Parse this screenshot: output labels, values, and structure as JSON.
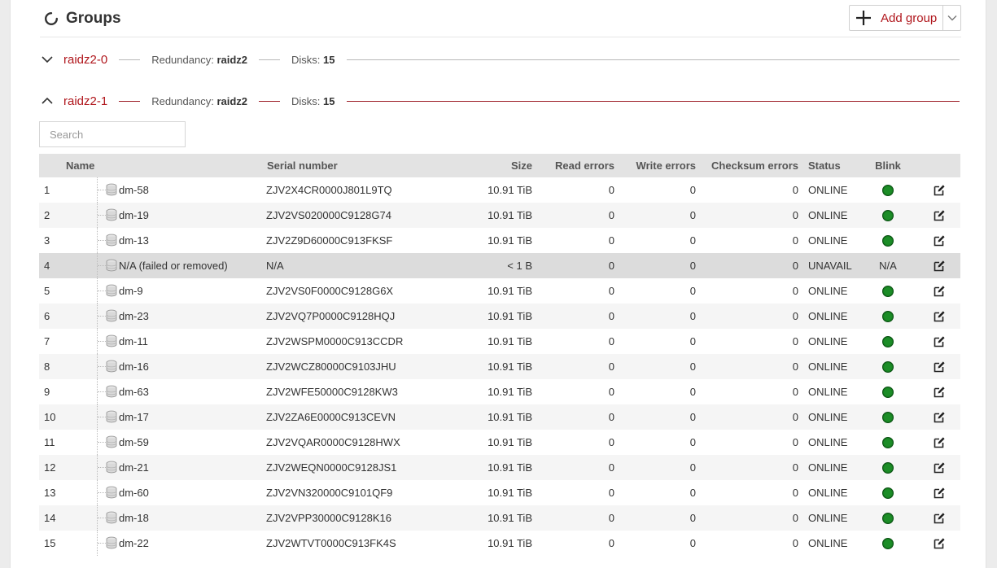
{
  "header": {
    "title": "Groups",
    "add_group_label": "Add group"
  },
  "groups": [
    {
      "name": "raidz2-0",
      "expanded": false,
      "redundancy_label": "Redundancy:",
      "redundancy": "raidz2",
      "disks_label": "Disks:",
      "disks": "15"
    },
    {
      "name": "raidz2-1",
      "expanded": true,
      "redundancy_label": "Redundancy:",
      "redundancy": "raidz2",
      "disks_label": "Disks:",
      "disks": "15"
    }
  ],
  "search": {
    "placeholder": "Search",
    "value": ""
  },
  "table": {
    "columns": [
      "Name",
      "Serial number",
      "Size",
      "Read errors",
      "Write errors",
      "Checksum errors",
      "Status",
      "Blink"
    ],
    "rows": [
      {
        "index": "1",
        "name": "dm-58",
        "serial": "ZJV2X4CR0000J801L9TQ",
        "size": "10.91 TiB",
        "read": "0",
        "write": "0",
        "checksum": "0",
        "status": "ONLINE",
        "blink": "dot"
      },
      {
        "index": "2",
        "name": "dm-19",
        "serial": "ZJV2VS020000C9128G74",
        "size": "10.91 TiB",
        "read": "0",
        "write": "0",
        "checksum": "0",
        "status": "ONLINE",
        "blink": "dot"
      },
      {
        "index": "3",
        "name": "dm-13",
        "serial": "ZJV2Z9D60000C913FKSF",
        "size": "10.91 TiB",
        "read": "0",
        "write": "0",
        "checksum": "0",
        "status": "ONLINE",
        "blink": "dot"
      },
      {
        "index": "4",
        "name": "N/A (failed or removed)",
        "serial": "N/A",
        "size": "< 1 B",
        "read": "0",
        "write": "0",
        "checksum": "0",
        "status": "UNAVAIL",
        "blink": "N/A"
      },
      {
        "index": "5",
        "name": "dm-9",
        "serial": "ZJV2VS0F0000C9128G6X",
        "size": "10.91 TiB",
        "read": "0",
        "write": "0",
        "checksum": "0",
        "status": "ONLINE",
        "blink": "dot"
      },
      {
        "index": "6",
        "name": "dm-23",
        "serial": "ZJV2VQ7P0000C9128HQJ",
        "size": "10.91 TiB",
        "read": "0",
        "write": "0",
        "checksum": "0",
        "status": "ONLINE",
        "blink": "dot"
      },
      {
        "index": "7",
        "name": "dm-11",
        "serial": "ZJV2WSPM0000C913CCDR",
        "size": "10.91 TiB",
        "read": "0",
        "write": "0",
        "checksum": "0",
        "status": "ONLINE",
        "blink": "dot"
      },
      {
        "index": "8",
        "name": "dm-16",
        "serial": "ZJV2WCZ80000C9103JHU",
        "size": "10.91 TiB",
        "read": "0",
        "write": "0",
        "checksum": "0",
        "status": "ONLINE",
        "blink": "dot"
      },
      {
        "index": "9",
        "name": "dm-63",
        "serial": "ZJV2WFE50000C9128KW3",
        "size": "10.91 TiB",
        "read": "0",
        "write": "0",
        "checksum": "0",
        "status": "ONLINE",
        "blink": "dot"
      },
      {
        "index": "10",
        "name": "dm-17",
        "serial": "ZJV2ZA6E0000C913CEVN",
        "size": "10.91 TiB",
        "read": "0",
        "write": "0",
        "checksum": "0",
        "status": "ONLINE",
        "blink": "dot"
      },
      {
        "index": "11",
        "name": "dm-59",
        "serial": "ZJV2VQAR0000C9128HWX",
        "size": "10.91 TiB",
        "read": "0",
        "write": "0",
        "checksum": "0",
        "status": "ONLINE",
        "blink": "dot"
      },
      {
        "index": "12",
        "name": "dm-21",
        "serial": "ZJV2WEQN0000C9128JS1",
        "size": "10.91 TiB",
        "read": "0",
        "write": "0",
        "checksum": "0",
        "status": "ONLINE",
        "blink": "dot"
      },
      {
        "index": "13",
        "name": "dm-60",
        "serial": "ZJV2VN320000C9101QF9",
        "size": "10.91 TiB",
        "read": "0",
        "write": "0",
        "checksum": "0",
        "status": "ONLINE",
        "blink": "dot"
      },
      {
        "index": "14",
        "name": "dm-18",
        "serial": "ZJV2VPP30000C9128K16",
        "size": "10.91 TiB",
        "read": "0",
        "write": "0",
        "checksum": "0",
        "status": "ONLINE",
        "blink": "dot"
      },
      {
        "index": "15",
        "name": "dm-22",
        "serial": "ZJV2WTVT0000C913FK4S",
        "size": "10.91 TiB",
        "read": "0",
        "write": "0",
        "checksum": "0",
        "status": "ONLINE",
        "blink": "dot"
      }
    ]
  },
  "icons": {
    "title": "refresh-circle-icon",
    "add": "plus-icon",
    "caret": "chevron-down-icon",
    "collapsed": "chevron-down-icon",
    "expanded": "chevron-up-icon",
    "disk": "disk-icon",
    "blink": "status-dot-icon",
    "edit": "edit-icon"
  },
  "colors": {
    "accent": "#b0161c",
    "online_dot": "#1c8d27",
    "failed_row": "#dcdcdc"
  }
}
